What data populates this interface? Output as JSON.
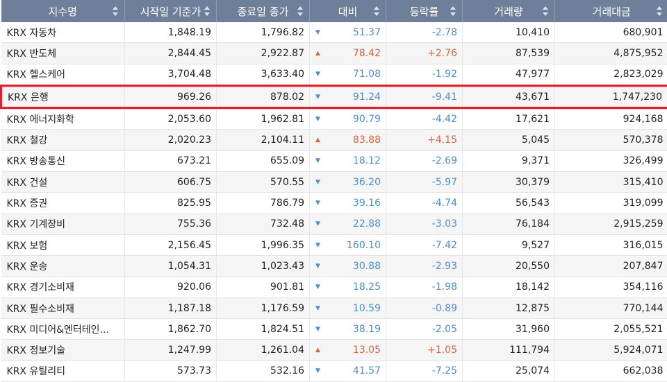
{
  "colors": {
    "header_bg": "#6e7f9a",
    "down": "#4a8fd0",
    "up": "#d9653b",
    "highlight": "#e0202a"
  },
  "headers": [
    "지수명",
    "시작일 기준가",
    "종료일 종가",
    "대비",
    "등락률",
    "거래량",
    "거래대금"
  ],
  "rows": [
    {
      "name": "KRX 자동차",
      "start": "1,848.19",
      "end": "1,796.82",
      "dir": "down",
      "diff": "51.37",
      "rate": "-2.78",
      "volume": "10,410",
      "amount": "680,901"
    },
    {
      "name": "KRX 반도체",
      "start": "2,844.45",
      "end": "2,922.87",
      "dir": "up",
      "diff": "78.42",
      "rate": "+2.76",
      "volume": "87,539",
      "amount": "4,875,952"
    },
    {
      "name": "KRX 헬스케어",
      "start": "3,704.48",
      "end": "3,633.40",
      "dir": "down",
      "diff": "71.08",
      "rate": "-1.92",
      "volume": "47,977",
      "amount": "2,823,029"
    },
    {
      "name": "KRX 은행",
      "start": "969.26",
      "end": "878.02",
      "dir": "down",
      "diff": "91.24",
      "rate": "-9.41",
      "volume": "43,671",
      "amount": "1,747,230",
      "highlight": true
    },
    {
      "name": "KRX 에너지화학",
      "start": "2,053.60",
      "end": "1,962.81",
      "dir": "down",
      "diff": "90.79",
      "rate": "-4.42",
      "volume": "17,621",
      "amount": "924,168"
    },
    {
      "name": "KRX 철강",
      "start": "2,020.23",
      "end": "2,104.11",
      "dir": "up",
      "diff": "83.88",
      "rate": "+4.15",
      "volume": "5,045",
      "amount": "570,378"
    },
    {
      "name": "KRX 방송통신",
      "start": "673.21",
      "end": "655.09",
      "dir": "down",
      "diff": "18.12",
      "rate": "-2.69",
      "volume": "9,371",
      "amount": "326,499"
    },
    {
      "name": "KRX 건설",
      "start": "606.75",
      "end": "570.55",
      "dir": "down",
      "diff": "36.20",
      "rate": "-5.97",
      "volume": "30,379",
      "amount": "315,410"
    },
    {
      "name": "KRX 증권",
      "start": "825.95",
      "end": "786.79",
      "dir": "down",
      "diff": "39.16",
      "rate": "-4.74",
      "volume": "56,543",
      "amount": "319,099"
    },
    {
      "name": "KRX 기계장비",
      "start": "755.36",
      "end": "732.48",
      "dir": "down",
      "diff": "22.88",
      "rate": "-3.03",
      "volume": "76,184",
      "amount": "2,915,259"
    },
    {
      "name": "KRX 보험",
      "start": "2,156.45",
      "end": "1,996.35",
      "dir": "down",
      "diff": "160.10",
      "rate": "-7.42",
      "volume": "9,527",
      "amount": "316,015"
    },
    {
      "name": "KRX 운송",
      "start": "1,054.31",
      "end": "1,023.43",
      "dir": "down",
      "diff": "30.88",
      "rate": "-2.93",
      "volume": "20,550",
      "amount": "207,847"
    },
    {
      "name": "KRX 경기소비재",
      "start": "920.06",
      "end": "901.81",
      "dir": "down",
      "diff": "18.25",
      "rate": "-1.98",
      "volume": "18,142",
      "amount": "354,116"
    },
    {
      "name": "KRX 필수소비재",
      "start": "1,187.18",
      "end": "1,176.59",
      "dir": "down",
      "diff": "10.59",
      "rate": "-0.89",
      "volume": "12,875",
      "amount": "770,144"
    },
    {
      "name": "KRX 미디어&엔터테인...",
      "start": "1,862.70",
      "end": "1,824.51",
      "dir": "down",
      "diff": "38.19",
      "rate": "-2.05",
      "volume": "31,960",
      "amount": "2,055,521"
    },
    {
      "name": "KRX 정보기술",
      "start": "1,247.99",
      "end": "1,261.04",
      "dir": "up",
      "diff": "13.05",
      "rate": "+1.05",
      "volume": "111,794",
      "amount": "5,924,071"
    },
    {
      "name": "KRX 유틸리티",
      "start": "573.73",
      "end": "532.16",
      "dir": "down",
      "diff": "41.57",
      "rate": "-7.25",
      "volume": "25,074",
      "amount": "662,038"
    }
  ]
}
